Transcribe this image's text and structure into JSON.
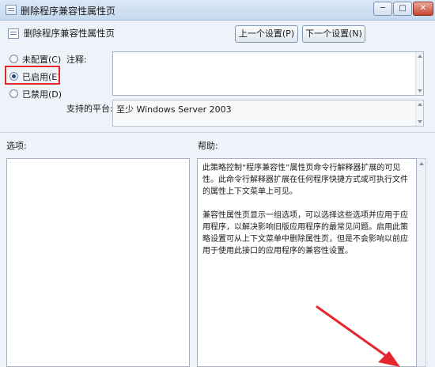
{
  "window": {
    "title": "删除程序兼容性属性页",
    "minimize": "─",
    "maximize": "□",
    "close": "✕"
  },
  "header": {
    "title": "删除程序兼容性属性页",
    "prev_label": "上一个设置(P)",
    "next_label": "下一个设置(N)"
  },
  "state": {
    "not_configured": "未配置(C)",
    "enabled": "已启用(E)",
    "disabled": "已禁用(D)",
    "selected": "enabled"
  },
  "comment": {
    "label": "注释:",
    "value": ""
  },
  "platform": {
    "label": "支持的平台:",
    "value": "至少 Windows Server 2003"
  },
  "options": {
    "label": "选项:"
  },
  "help": {
    "label": "帮助:",
    "paragraphs": [
      "此策略控制“程序兼容性”属性页命令行解释器扩展的可见性。此命令行解释器扩展在任何程序快捷方式或可执行文件的属性上下文菜单上可见。",
      "兼容性属性页显示一组选项，可以选择这些选项并应用于应用程序，以解决影响旧版应用程序的最常见问题。启用此策略设置可从上下文菜单中删除属性页，但是不会影响以前应用于使用此接口的应用程序的兼容性设置。"
    ]
  },
  "colors": {
    "highlight": "#e5262e",
    "arrow": "#e5262e"
  },
  "icons": {
    "window": "policy-window-icon",
    "header": "policy-setting-icon",
    "annotation": "red-arrow"
  }
}
